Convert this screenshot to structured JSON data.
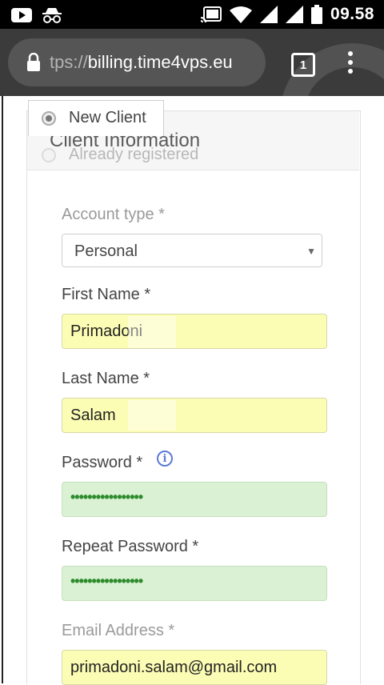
{
  "status_bar": {
    "time": "09.58",
    "icons": [
      "youtube-icon",
      "incognito-icon",
      "cast-icon",
      "wifi-icon",
      "signal-icon",
      "signal-icon",
      "battery-icon"
    ]
  },
  "browser": {
    "url_scheme": "tps://",
    "url_host": "billing.time4vps.eu",
    "tab_count": "1"
  },
  "popover": {
    "options": [
      {
        "label": "New Client",
        "selected": true
      },
      {
        "label": "Already registered",
        "selected": false
      }
    ]
  },
  "card": {
    "title": "Client Information"
  },
  "form": {
    "account_type": {
      "label": "Account type *",
      "value": "Personal"
    },
    "first_name": {
      "label": "First Name *",
      "value": "Primadoni"
    },
    "last_name": {
      "label": "Last Name *",
      "value": "Salam"
    },
    "password": {
      "label": "Password *",
      "value": "•••••••••••••••••",
      "info_icon": "i"
    },
    "repeat_password": {
      "label": "Repeat Password *",
      "value": "•••••••••••••••••"
    },
    "email": {
      "label": "Email Address *",
      "value": "primadoni.salam@gmail.com"
    }
  },
  "colors": {
    "toolbar": "#3b3b3b",
    "autofill_yellow": "#fcfdb4",
    "autofill_green": "#dbf1d3",
    "info_blue": "#5b7bd6"
  }
}
